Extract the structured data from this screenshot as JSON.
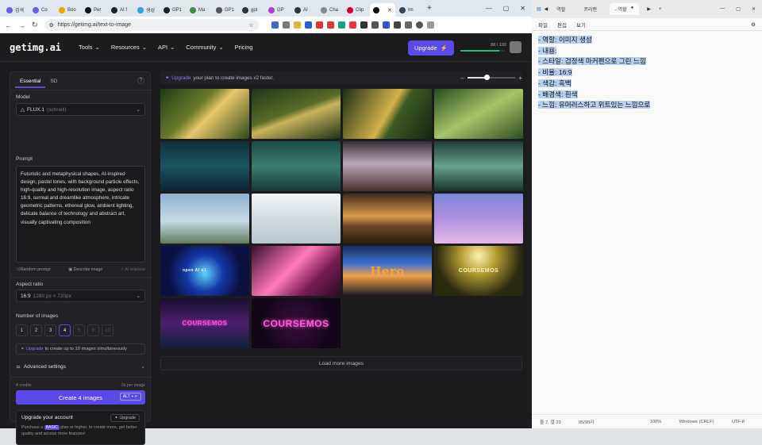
{
  "browser": {
    "tabs": [
      {
        "label": "검색",
        "color": "#6c5ce7"
      },
      {
        "label": "Co",
        "color": "#6c5ce7"
      },
      {
        "label": "Boo",
        "color": "#f0a500"
      },
      {
        "label": "Per",
        "color": "#111"
      },
      {
        "label": "AI f",
        "color": "#222"
      },
      {
        "label": "생성",
        "color": "#2aa6d9"
      },
      {
        "label": "GP1",
        "color": "#222"
      },
      {
        "label": "Ma",
        "color": "#3b8f3b"
      },
      {
        "label": "GP1",
        "color": "#555"
      },
      {
        "label": "gpt",
        "color": "#333"
      },
      {
        "label": "GP",
        "color": "#b03bd1"
      },
      {
        "label": "AI",
        "color": "#333"
      },
      {
        "label": "Cha",
        "color": "#888"
      },
      {
        "label": "Clip",
        "color": "#c03"
      },
      {
        "label": "",
        "color": "#111",
        "active": true
      },
      {
        "label": "Im",
        "color": "#345"
      }
    ],
    "url": "https://getimg.ai/text-to-image"
  },
  "site": {
    "logo": "getimg.ai",
    "nav": [
      "Tools",
      "Resources",
      "API",
      "Community",
      "Pricing"
    ],
    "upgrade_label": "Upgrade",
    "credits_text": "88 / 100",
    "credits_fraction": 0.88
  },
  "panel": {
    "tab_essential": "Essential",
    "tab_sd": "SD",
    "model_label": "Model",
    "model_value": "FLUX.1",
    "model_variant": "(schnell)",
    "prompt_label": "Prompt",
    "prompt_text": "Futuristic and metaphysical shapes, AI-inspired design, pastel tones, with background particle effects, high-quality and high-resolution image, aspect ratio 16:9, surreal and dreamlike atmosphere, intricate geometric patterns, ethereal glow, ambient lighting, delicate balance of technology and abstract art, visually captivating composition",
    "random_prompt": "Random prompt",
    "describe_image": "Describe image",
    "ai_improve": "AI Improve",
    "aspect_label": "Aspect ratio",
    "aspect_value": "16:9",
    "aspect_size": "1280 px × 720px",
    "num_label": "Number of images",
    "num_options": [
      "1",
      "2",
      "3",
      "4",
      "6",
      "8",
      "10"
    ],
    "num_selected": "4",
    "upgrade_link": "Upgrade",
    "upgrade_note": "to create up to 10 images simultaneously",
    "advanced": "Advanced settings",
    "credits_cost": "4 credits",
    "per_image": "0s per image",
    "create_label": "Create 4 images",
    "create_shortcut": "ALT + ↵",
    "upbox_title": "Upgrade your account",
    "upbox_button": "Upgrade",
    "upbox_text_1": "Purchase a",
    "upbox_badge": "BASIC",
    "upbox_text_2": "plan or higher, to create more, get better quality and access more features!"
  },
  "gallery": {
    "banner_link": "Upgrade",
    "banner_text": "your plan to create images x2 faster.",
    "zoom_level": 0.4,
    "load_more": "Load more images",
    "images": [
      {
        "caption": "",
        "bg": "linear-gradient(135deg,#1f3b16,#6b7a2a 40%,#e8c56a 55%,#2d4a1c)"
      },
      {
        "caption": "",
        "bg": "linear-gradient(160deg,#20361a,#5a6b26 45%,#c9b35c 55%,#1d3316)"
      },
      {
        "caption": "",
        "bg": "linear-gradient(120deg,#1c2e14,#d4b24a 50%,#3c5a22 60%,#142610)"
      },
      {
        "caption": "",
        "bg": "linear-gradient(150deg,#284a1f,#a8c468 50%,#2e4d22)"
      },
      {
        "caption": "",
        "bg": "linear-gradient(180deg,#0f2f3a,#1c5463 50%,#0d2430)"
      },
      {
        "caption": "",
        "bg": "linear-gradient(180deg,#1a4b48,#3b7d6f 50%,#163a38)"
      },
      {
        "caption": "",
        "bg": "linear-gradient(180deg,#3a2d3a,#b9a8b8 45%,#4b2e2e)"
      },
      {
        "caption": "",
        "bg": "linear-gradient(180deg,#1c3d35,#6aa08e 50%,#16332b)"
      },
      {
        "caption": "",
        "bg": "linear-gradient(180deg,#8fb2cf,#c8d8e6 55%,#5f7d5f)"
      },
      {
        "caption": "",
        "bg": "linear-gradient(180deg,#f4f6f8,#cfd8df 55%,#b9c6cf)"
      },
      {
        "caption": "",
        "bg": "linear-gradient(180deg,#3b2a1c,#d89b4a 45%,#6b4824 65%,#2b1d12)"
      },
      {
        "caption": "",
        "bg": "linear-gradient(180deg,#7a86d8,#b18fe0 50%,#e4b8e6)"
      },
      {
        "caption": "open AI o1",
        "bg": "radial-gradient(circle at 50% 55%,#5fd4ff,#1538a8 35%,#0a1140 70%)"
      },
      {
        "caption": "",
        "bg": "linear-gradient(135deg,#3b0f2e,#ff7ab6 45%,#7b1e54 70%,#2a0a20)"
      },
      {
        "caption": "Hero",
        "bg": "linear-gradient(180deg,#1c2f5a,#3b6fd1 35%,#f0a14a 60%,#1a1a24)"
      },
      {
        "caption": "COURSEMOS",
        "bg": "radial-gradient(circle at 50% 20%,#fff3b0,#b49b34 30%,#2b2a10 70%)"
      },
      {
        "caption": "COURSEMOS",
        "bg": "linear-gradient(180deg,#1a1030,#4a1f6b 50%,#12203a)"
      },
      {
        "caption": "COURSEMOS",
        "bg": "radial-gradient(circle at 50% 50%,#3a0f3d,#120618 70%)"
      }
    ]
  },
  "notepad": {
    "tabs": [
      "역할",
      "프리랜",
      "- 역할"
    ],
    "menu": [
      "파일",
      "편집",
      "보기"
    ],
    "lines": [
      "- 역할: 이미지 생성",
      "- 내용:",
      "- 스타일: 검정색 마커펜으로 그린 느낌",
      "- 비율: 16:9",
      "- 색감: 흑백",
      "- 배경색: 흰색",
      "- 느낌: 유머러스하고 위트있는 느낌으로"
    ],
    "status": [
      "줄 7, 열 23",
      "95/95자",
      "100%",
      "Windows (CRLF)",
      "UTF-8"
    ]
  }
}
